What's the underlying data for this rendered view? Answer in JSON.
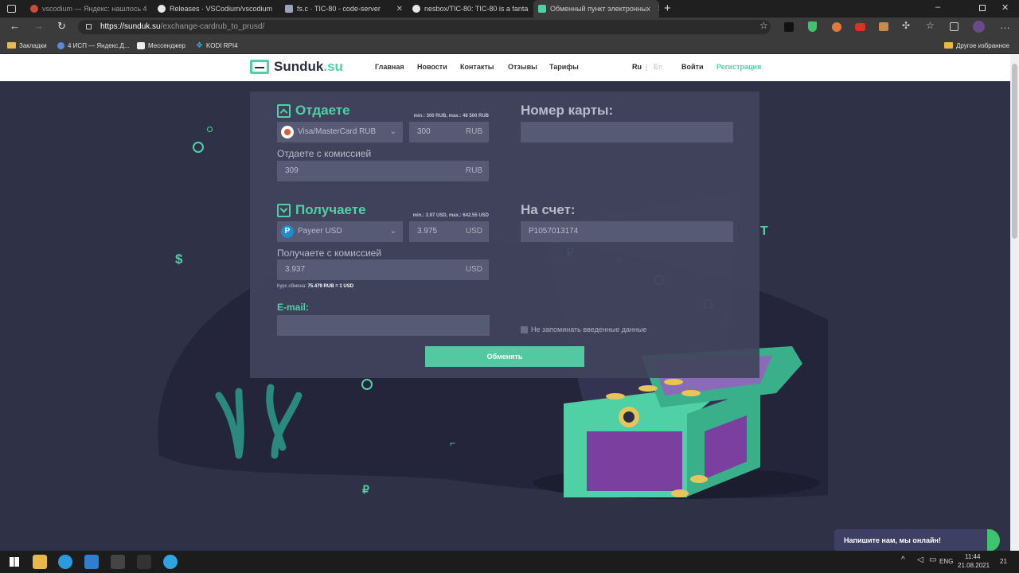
{
  "tabs": [
    {
      "label": "vscodium — Яндекс: нашлось 4",
      "color": "#d04a3a"
    },
    {
      "label": "Releases · VSCodium/vscodium",
      "color": "#e8e8e8"
    },
    {
      "label": "fs.c · TIC-80 - code-server",
      "color": "#9aa4b5"
    },
    {
      "label": "nesbox/TIC-80: TIC-80 is a fanta",
      "color": "#e8e8e8"
    },
    {
      "label": "Обменный пункт электронных",
      "color": "#4fd1a5"
    }
  ],
  "browser": {
    "url_host": "https://sunduk.su",
    "url_path": "/exchange-cardrub_to_prusd/",
    "bookmarks": [
      "Закладки",
      "4 ИСП — Яндекс.Д...",
      "Мессенджер",
      "KODI RPI4"
    ],
    "other_bookmarks": "Другое избранное"
  },
  "site": {
    "logo_main": "Sunduk",
    "logo_dot": ".su",
    "nav": [
      "Главная",
      "Новости",
      "Контакты",
      "Отзывы",
      "Тарифы"
    ],
    "lang_ru": "Ru",
    "lang_sep": "|",
    "lang_en": "En",
    "login": "Войти",
    "register": "Регистрация"
  },
  "form": {
    "give_title": "Отдаете",
    "give_limits": "min.: 300 RUB, max.: 48 500 RUB",
    "give_currency": "Visa/MasterCard RUB",
    "give_amount": "300",
    "give_unit": "RUB",
    "give_fee_label": "Отдаете с комиссией",
    "give_fee_value": "309",
    "give_fee_unit": "RUB",
    "card_label": "Номер карты:",
    "receive_title": "Получаете",
    "receive_limits": "min.: 3.97 USD, max.: 642.55 USD",
    "receive_currency": "Payeer USD",
    "receive_amount": "3.975",
    "receive_unit": "USD",
    "receive_fee_label": "Получаете с комиссией",
    "receive_fee_value": "3.937",
    "receive_fee_unit": "USD",
    "rate_label": "Курс обмена:",
    "rate_value": "75.479 RUB = 1 USD",
    "account_label": "На счет:",
    "account_value": "P1057013174",
    "email_label": "E-mail:",
    "remember_label": "Не запоминать введенные данные",
    "submit": "Обменять"
  },
  "chat": "Напишите нам, мы онлайн!",
  "taskbar": {
    "lang": "ENG",
    "time": "11:44",
    "date": "21.08.2021",
    "notif": "21"
  }
}
